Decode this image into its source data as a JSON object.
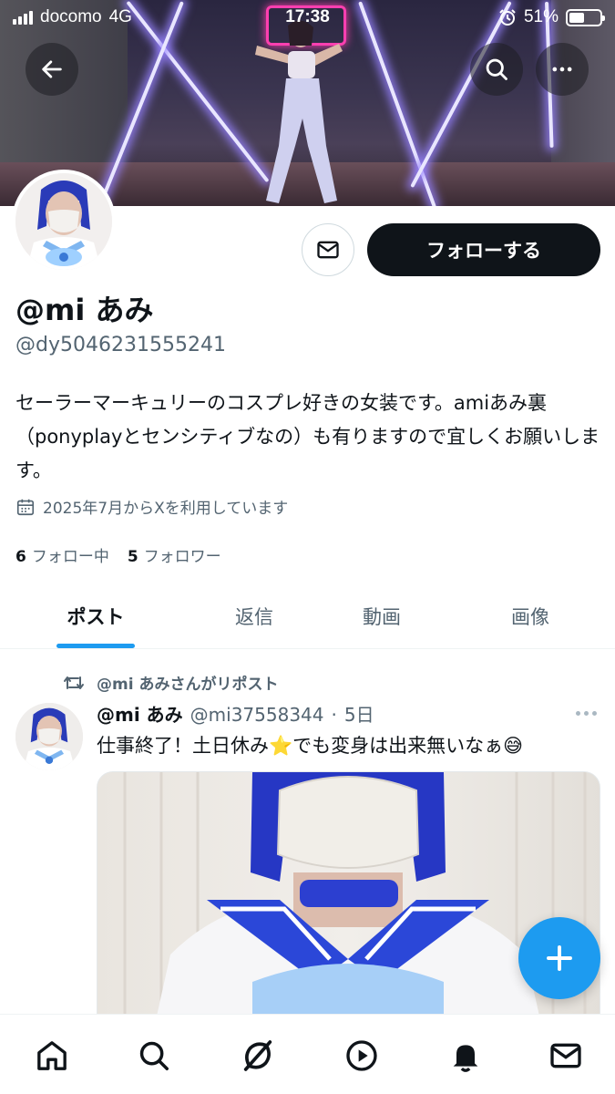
{
  "status_bar": {
    "carrier": "docomo",
    "network": "4G",
    "time": "17:38",
    "battery_percent_label": "51%",
    "battery_level": 0.51
  },
  "profile": {
    "display_name": "@mi あみ",
    "handle": "@dy5046231555241",
    "bio": "セーラーマーキュリーのコスプレ好きの女装です。amiあみ裏（ponyplayとセンシティブなの）も有りますので宜しくお願いします。",
    "joined": "2025年7月からXを利用しています",
    "following_count": "6",
    "following_label": "フォロー中",
    "followers_count": "5",
    "followers_label": "フォロワー",
    "follow_button": "フォローする"
  },
  "tabs": [
    "ポスト",
    "返信",
    "動画",
    "画像"
  ],
  "active_tab": 0,
  "post": {
    "repost_label": "@mi あみさんがリポスト",
    "author_name": "@mi あみ",
    "author_handle": "@mi37558344",
    "separator": "·",
    "age": "5日",
    "text": "仕事終了！土日休み⭐でも変身は出来無いなぁ😅"
  },
  "icons": {
    "back": "back-arrow-icon",
    "search": "search-icon",
    "more": "more-icon",
    "message": "mail-icon",
    "calendar": "calendar-icon",
    "repost": "repost-icon",
    "compose": "plus-icon",
    "nav": [
      "home-icon",
      "search-icon",
      "grok-icon",
      "play-icon",
      "bell-icon",
      "mail-icon"
    ]
  },
  "colors": {
    "accent": "#1d9bf0",
    "primary_text": "#0f1419",
    "secondary_text": "#536471",
    "follow_button_bg": "#0f1419"
  }
}
